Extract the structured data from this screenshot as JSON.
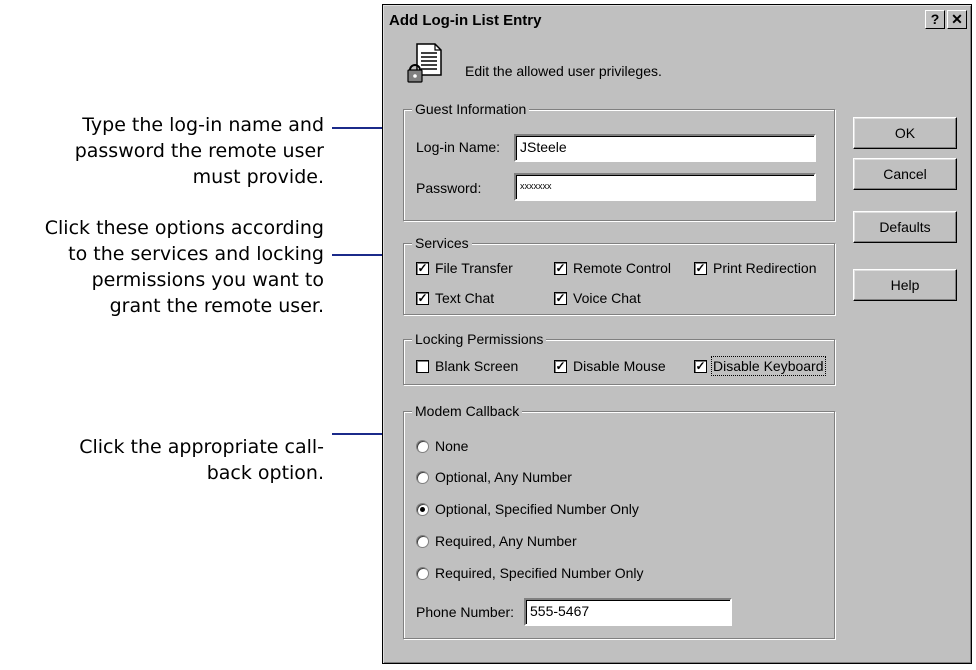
{
  "callouts": {
    "login": [
      "Type the log-in name and",
      "password the remote user",
      "must provide."
    ],
    "services": [
      "Click these options according",
      "to the services and locking",
      "permissions you want to",
      "grant the remote user."
    ],
    "callback": [
      "Click the appropriate call-",
      "back option."
    ]
  },
  "dialog": {
    "title": "Add Log-in List Entry",
    "help_button": "?",
    "close_button": "✕",
    "icon": "document-lock-icon",
    "description": "Edit the allowed user privileges."
  },
  "guest": {
    "legend": "Guest Information",
    "login_label": "Log-in Name:",
    "login_value": "JSteele",
    "password_label": "Password:",
    "password_value": "xxxxxxx"
  },
  "services": {
    "legend": "Services",
    "items": [
      {
        "label": "File Transfer",
        "checked": true
      },
      {
        "label": "Remote Control",
        "checked": true
      },
      {
        "label": "Print Redirection",
        "checked": true
      },
      {
        "label": "Text Chat",
        "checked": true
      },
      {
        "label": "Voice Chat",
        "checked": true
      }
    ]
  },
  "locking": {
    "legend": "Locking Permissions",
    "items": [
      {
        "label": "Blank Screen",
        "checked": false
      },
      {
        "label": "Disable Mouse",
        "checked": true
      },
      {
        "label": "Disable Keyboard",
        "checked": true
      }
    ]
  },
  "callback": {
    "legend": "Modem Callback",
    "options": [
      {
        "label": "None",
        "selected": false
      },
      {
        "label": "Optional, Any Number",
        "selected": false
      },
      {
        "label": "Optional, Specified Number Only",
        "selected": true
      },
      {
        "label": "Required, Any Number",
        "selected": false
      },
      {
        "label": "Required, Specified Number Only",
        "selected": false
      }
    ],
    "phone_label": "Phone Number:",
    "phone_value": "555-5467"
  },
  "buttons": {
    "ok": "OK",
    "cancel": "Cancel",
    "defaults": "Defaults",
    "help": "Help"
  },
  "colors": {
    "leader": "#1b2a8a",
    "dialog_face": "#c0c0c0"
  }
}
